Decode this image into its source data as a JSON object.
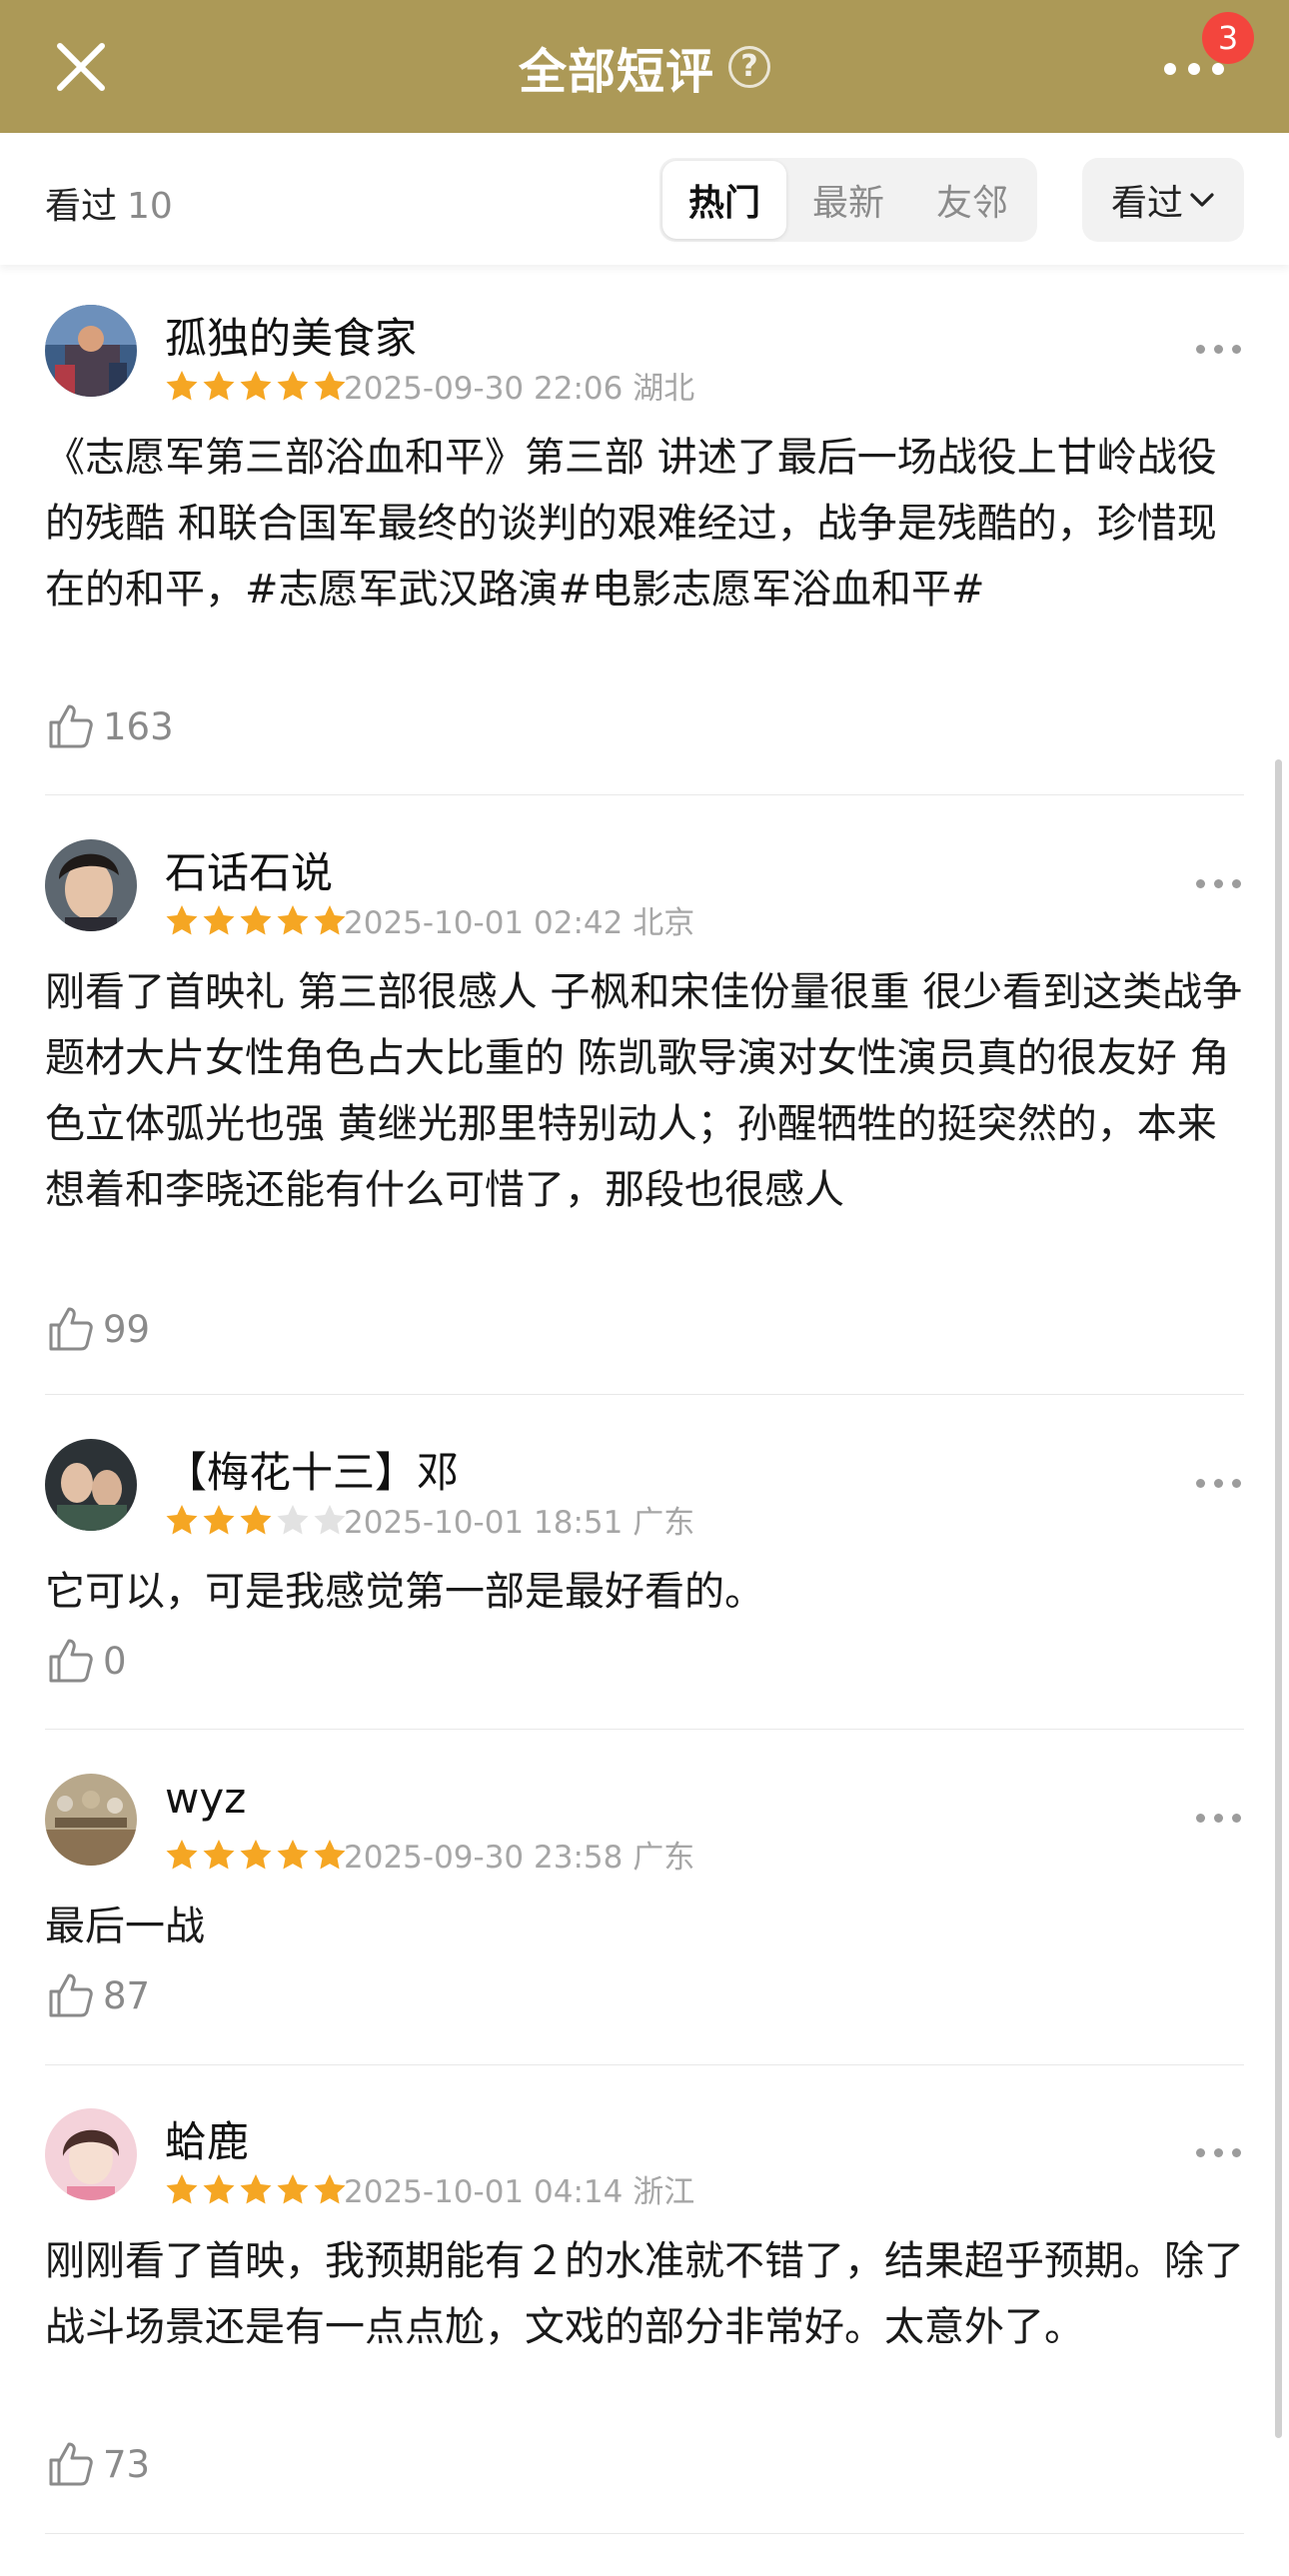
{
  "header": {
    "title": "全部短评",
    "help_icon": "question-circle-icon",
    "close_icon": "close-icon",
    "more_icon": "more-dots-icon",
    "notification_count": "3",
    "bg_color": "#ac9957"
  },
  "filter_bar": {
    "seen_label": "看过",
    "seen_count": "10",
    "tabs": [
      {
        "label": "热门",
        "active": true
      },
      {
        "label": "最新",
        "active": false
      },
      {
        "label": "友邻",
        "active": false
      }
    ],
    "dropdown_label": "看过"
  },
  "reviews": [
    {
      "username": "孤独的美食家",
      "rating": 5,
      "date": "2025-09-30 22:06",
      "location": "湖北",
      "text": "《志愿军第三部浴血和平》第三部 讲述了最后一场战役上甘岭战役的残酷 和联合国军最终的谈判的艰难经过，战争是残酷的，珍惜现在的和平，#志愿军武汉路演#电影志愿军浴血和平#",
      "likes": "163"
    },
    {
      "username": "石话石说",
      "rating": 5,
      "date": "2025-10-01 02:42",
      "location": "北京",
      "text": "刚看了首映礼 第三部很感人 子枫和宋佳份量很重 很少看到这类战争题材大片女性角色占大比重的 陈凯歌导演对女性演员真的很友好 角色立体弧光也强 黄继光那里特别动人；孙醒牺牲的挺突然的，本来想着和李晓还能有什么可惜了，那段也很感人",
      "likes": "99"
    },
    {
      "username": "【梅花十三】邓",
      "rating": 3,
      "date": "2025-10-01 18:51",
      "location": "广东",
      "text": "它可以，可是我感觉第一部是最好看的。",
      "likes": "0"
    },
    {
      "username": "wyz",
      "rating": 5,
      "date": "2025-09-30 23:58",
      "location": "广东",
      "text": "最后一战",
      "likes": "87"
    },
    {
      "username": "蛤鹿",
      "rating": 5,
      "date": "2025-10-01 04:14",
      "location": "浙江",
      "text": "刚刚看了首映，我预期能有２的水准就不错了，结果超乎预期。除了战斗场景还是有一点点尬，文戏的部分非常好。太意外了。",
      "likes": "73"
    }
  ],
  "colors": {
    "star_filled": "#f5a623",
    "star_empty": "#e2e2e2"
  }
}
